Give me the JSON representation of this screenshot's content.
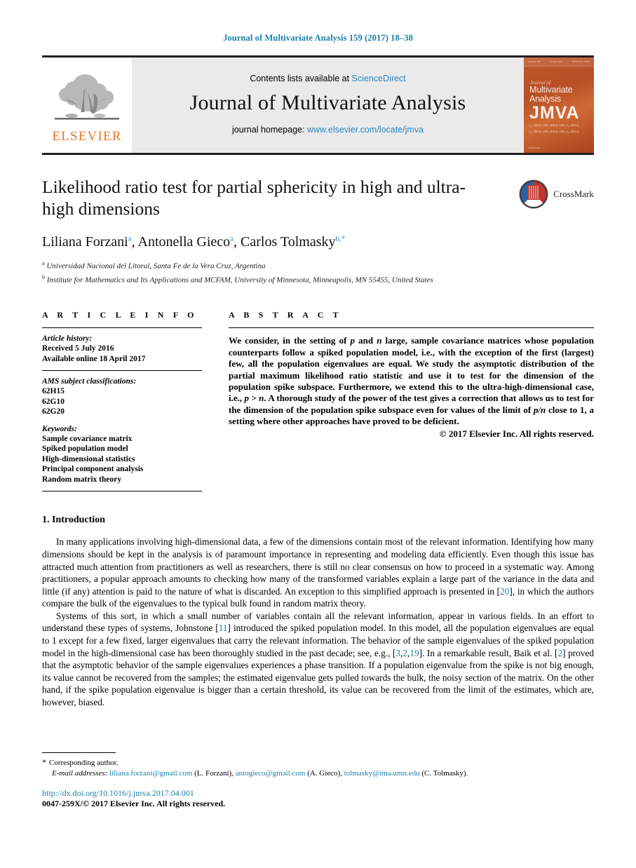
{
  "running_head": "Journal of Multivariate Analysis 159 (2017) 18–38",
  "masthead": {
    "contents_prefix": "Contents lists available at ",
    "sciencedirect": "ScienceDirect",
    "journal_name": "Journal of Multivariate Analysis",
    "homepage_prefix": "journal homepage: ",
    "homepage_url": "www.elsevier.com/locate/jmva",
    "publisher": "ELSEVIER",
    "cover": {
      "top_bar_left": "Volume 159",
      "top_bar_mid": "October 2017",
      "top_bar_right": "ISSN 0047-259X",
      "journal_of": "Journal of",
      "line1": "Multivariate",
      "line2": "Analysis",
      "acronym": "JMVA",
      "formula": "σ₁₁ λΣθ₁θ₂ λΣθ₁ λΣθ₂θ₁ λΣθ₂ σ₂₂ λΣθ₁θ₂",
      "imprint": "ELSEVIER"
    }
  },
  "article": {
    "title": "Likelihood ratio test for partial sphericity in high and ultra-high dimensions",
    "authors": [
      {
        "name": "Liliana Forzani",
        "marks": "a"
      },
      {
        "name": "Antonella Gieco",
        "marks": "a"
      },
      {
        "name": "Carlos Tolmasky",
        "marks": "b,*"
      }
    ],
    "affiliations": [
      {
        "mark": "a",
        "text": "Universidad Nacional del Litoral, Santa Fe de la Vera Cruz, Argentina"
      },
      {
        "mark": "b",
        "text": "Institute for Mathematics and Its Applications and MCFAM, University of Minnesota, Minneapolis, MN 55455, United States"
      }
    ],
    "crossmark_label": "CrossMark"
  },
  "article_info": {
    "heading": "A R T I C L E   I N F O",
    "history_label": "Article history:",
    "history": [
      "Received 5 July 2016",
      "Available online 18 April 2017"
    ],
    "ams_label": "AMS subject classifications:",
    "ams": [
      "62H15",
      "62G10",
      "62G20"
    ],
    "keywords_label": "Keywords:",
    "keywords": [
      "Sample covariance matrix",
      "Spiked population model",
      "High-dimensional statistics",
      "Principal component analysis",
      "Random matrix theory"
    ]
  },
  "abstract": {
    "heading": "A B S T R A C T",
    "text_part1": "We consider, in the setting of ",
    "p1": "p",
    "text_part2": " and ",
    "n1": "n",
    "text_part3": " large, sample covariance matrices whose population counterparts follow a spiked population model, i.e., with the exception of the first (largest) few, all the population eigenvalues are equal. We study the asymptotic distribution of the partial maximum likelihood ratio statistic and use it to test for the dimension of the population spike subspace. Furthermore, we extend this to the ultra-high-dimensional case, i.e., ",
    "formula1": "p > n",
    "text_part4": ". A thorough study of the power of the test gives a correction that allows us to test for the dimension of the population spike subspace even for values of the limit of ",
    "formula2": "p/n",
    "text_part5": " close to 1, a setting where other approaches have proved to be deficient.",
    "copyright": "© 2017 Elsevier Inc. All rights reserved."
  },
  "introduction": {
    "heading": "1. Introduction",
    "p1_a": "In many applications involving high-dimensional data, a few of the dimensions contain most of the relevant information. Identifying how many dimensions should be kept in the analysis is of paramount importance in representing and modeling data efficiently. Even though this issue has attracted much attention from practitioners as well as researchers, there is still no clear consensus on how to proceed in a systematic way. Among practitioners, a popular approach amounts to checking how many of the transformed variables explain a large part of the variance in the data and little (if any) attention is paid to the nature of what is discarded. An exception to this simplified approach is presented in [",
    "p1_ref": "20",
    "p1_b": "], in which the authors compare the bulk of the eigenvalues to the typical bulk found in random matrix theory.",
    "p2_a": "Systems of this sort, in which a small number of variables contain all the relevant information, appear in various fields. In an effort to understand these types of systems, Johnstone [",
    "p2_ref1": "11",
    "p2_b": "] introduced the spiked population model. In this model, all the population eigenvalues are equal to 1 except for a few fixed, larger eigenvalues that carry the relevant information. The behavior of the sample eigenvalues of the spiked population model in the high-dimensional case has been thoroughly studied in the past decade; see, e.g., [",
    "p2_ref2": "3",
    "p2_c": ",",
    "p2_ref3": "2",
    "p2_d": ",",
    "p2_ref4": "19",
    "p2_e": "]. In a remarkable result, Baik et al. [",
    "p2_ref5": "2",
    "p2_f": "] proved that the asymptotic behavior of the sample eigenvalues experiences a phase transition. If a population eigenvalue from the spike is not big enough, its value cannot be recovered from the samples; the estimated eigenvalue gets pulled towards the bulk, the noisy section of the matrix. On the other hand, if the spike population eigenvalue is bigger than a certain threshold, its value can be recovered from the limit of the estimates, which are, however, biased."
  },
  "footer": {
    "corresponding": "Corresponding author.",
    "email_label": "E-mail addresses:",
    "emails": [
      {
        "address": "liliana.forzani@gmail.com",
        "who": "(L. Forzani)"
      },
      {
        "address": "antogieco@gmail.com",
        "who": "(A. Gieco)"
      },
      {
        "address": "tolmasky@ima.umn.edu",
        "who": "(C. Tolmasky)"
      }
    ],
    "doi": "http://dx.doi.org/10.1016/j.jmva.2017.04.001",
    "issn": "0047-259X/© 2017 Elsevier Inc. All rights reserved."
  },
  "colors": {
    "link_blue": "#1b7fa8",
    "sciencedirect_blue": "#2b86c5",
    "elsevier_orange": "#e87722",
    "cover_orange": "#c05a2d"
  }
}
